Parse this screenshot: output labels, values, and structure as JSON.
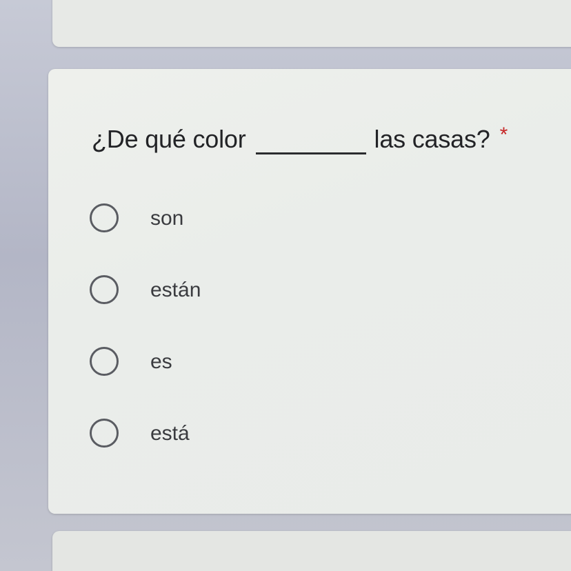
{
  "question": {
    "text_before": "¿De qué color",
    "text_after": "las casas?",
    "required_mark": "*"
  },
  "options": [
    {
      "label": "son",
      "selected": false
    },
    {
      "label": "están",
      "selected": false
    },
    {
      "label": "es",
      "selected": false
    },
    {
      "label": "está",
      "selected": false
    }
  ],
  "colors": {
    "required": "#c62828",
    "card": "#eceee9",
    "background": "#b9bccb"
  }
}
